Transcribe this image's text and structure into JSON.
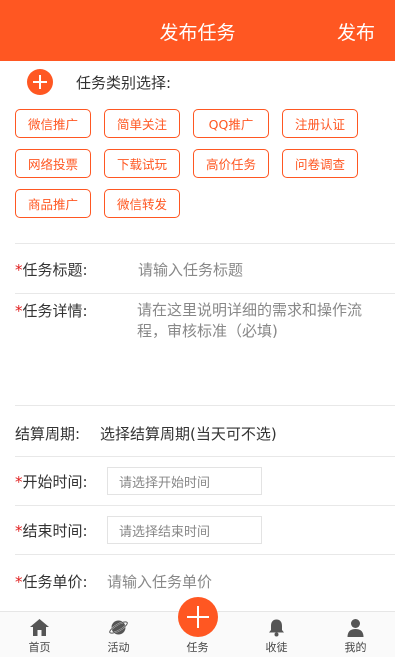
{
  "header": {
    "title": "发布任务",
    "publish_label": "发布"
  },
  "category": {
    "label": "任务类别选择:",
    "tags": [
      "微信推广",
      "简单关注",
      "QQ推广",
      "注册认证",
      "网络投票",
      "下载试玩",
      "高价任务",
      "问卷调查",
      "商品推广",
      "微信转发"
    ]
  },
  "form": {
    "required_mark": "*",
    "title_label": "任务标题:",
    "title_placeholder": "请输入任务标题",
    "detail_label": "任务详情:",
    "detail_placeholder": "请在这里说明详细的需求和操作流程，审核标准（必填)",
    "period_label": "结算周期:",
    "period_value": "选择结算周期(当天可不选)",
    "start_label": "开始时间:",
    "start_placeholder": "请选择开始时间",
    "end_label": "结束时间:",
    "end_placeholder": "请选择结束时间",
    "price_label": "任务单价:",
    "price_placeholder": "请输入任务单价"
  },
  "tabbar": {
    "items": [
      {
        "label": "首页",
        "icon": "home-icon"
      },
      {
        "label": "活动",
        "icon": "planet-icon"
      },
      {
        "label": "任务",
        "icon": "plus-icon"
      },
      {
        "label": "收徒",
        "icon": "bell-icon"
      },
      {
        "label": "我的",
        "icon": "user-icon"
      }
    ]
  },
  "colors": {
    "accent": "#ff5722",
    "required": "#e02020"
  }
}
